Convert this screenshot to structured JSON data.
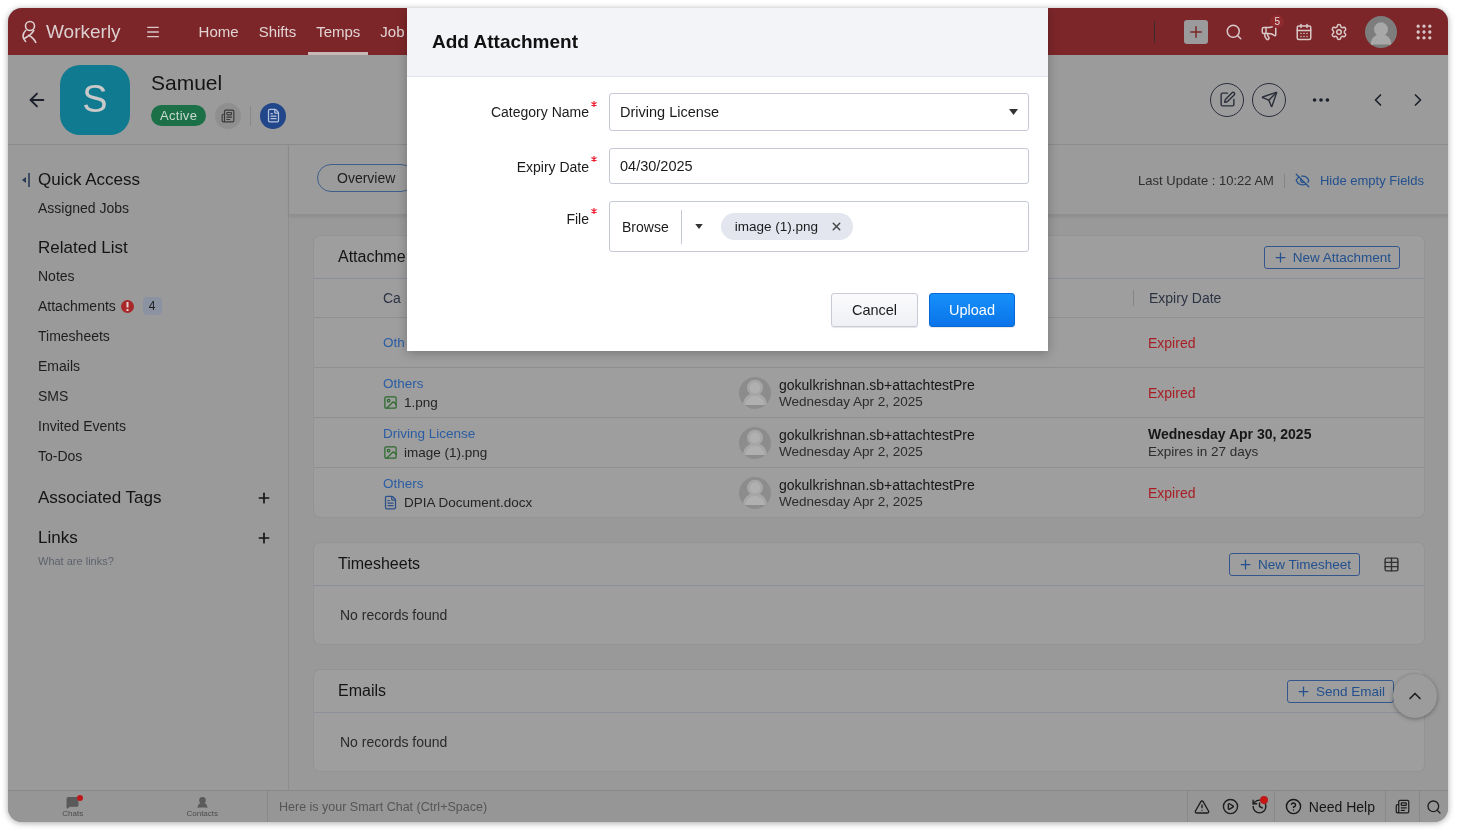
{
  "app": {
    "name": "Workerly"
  },
  "nav": [
    {
      "label": "Home",
      "selected": false
    },
    {
      "label": "Shifts",
      "selected": false
    },
    {
      "label": "Temps",
      "selected": true
    },
    {
      "label": "Job",
      "selected": false
    }
  ],
  "notifications_badge": "5",
  "profile": {
    "initial": "S",
    "name": "Samuel",
    "status": "Active"
  },
  "sidebar": {
    "sections": [
      {
        "title": "Quick Access",
        "items": [
          {
            "label": "Assigned Jobs",
            "alert": false
          }
        ]
      },
      {
        "title": "Related List",
        "items": [
          {
            "label": "Notes",
            "alert": false
          },
          {
            "label": "Attachments",
            "alert": true,
            "count": "4"
          },
          {
            "label": "Timesheets",
            "alert": false
          },
          {
            "label": "Emails",
            "alert": false
          },
          {
            "label": "SMS",
            "alert": false
          },
          {
            "label": "Invited Events",
            "alert": false
          },
          {
            "label": "To-Dos",
            "alert": false
          }
        ]
      }
    ],
    "tags": {
      "title": "Associated Tags"
    },
    "links": {
      "title": "Links",
      "hint": "What are links?"
    }
  },
  "tabs": [
    {
      "label": "Overview",
      "selected": true
    }
  ],
  "last_update": "Last Update : 10:22 AM",
  "hide_empty_link": "Hide empty Fields",
  "attachments": {
    "title": "Attachme",
    "button": "New Attachment",
    "columns": [
      "Ca",
      "Expiry Date"
    ],
    "rows": [
      {
        "category": "Oth",
        "expiry": {
          "text": "Expired",
          "expired": true
        }
      },
      {
        "category": "Others",
        "file": "1.png",
        "kind": "image",
        "uploader": "gokulkrishnan.sb+attachtestPre",
        "uploaded": "Wednesday Apr 2, 2025",
        "expiry": {
          "text": "Expired",
          "expired": true
        }
      },
      {
        "category": "Driving License",
        "file": "image (1).png",
        "kind": "image",
        "uploader": "gokulkrishnan.sb+attachtestPre",
        "uploaded": "Wednesday Apr 2, 2025",
        "expiry": {
          "text": "Wednesday Apr 30, 2025",
          "note": "Expires in 27 days",
          "expired": false
        }
      },
      {
        "category": "Others",
        "file": "DPIA Document.docx",
        "kind": "doc",
        "uploader": "gokulkrishnan.sb+attachtestPre",
        "uploaded": "Wednesday Apr 2, 2025",
        "expiry": {
          "text": "Expired",
          "expired": true
        }
      }
    ]
  },
  "timesheets": {
    "title": "Timesheets",
    "button": "New Timesheet",
    "empty": "No records found"
  },
  "emails": {
    "title": "Emails",
    "button": "Send Email",
    "empty": "No records found"
  },
  "bottom_bar": {
    "apps": [
      {
        "label": "Chats",
        "unread": true
      },
      {
        "label": "Contacts",
        "unread": false
      }
    ],
    "chat_placeholder": "Here is your Smart Chat (Ctrl+Space)",
    "help": "Need Help",
    "history_alert": true
  },
  "modal": {
    "title": "Add Attachment",
    "fields": [
      {
        "kind": "select",
        "label": "Category Name",
        "required": true,
        "value": "Driving License"
      },
      {
        "kind": "text",
        "label": "Expiry Date",
        "required": true,
        "value": "04/30/2025"
      },
      {
        "kind": "file",
        "label": "File",
        "required": true,
        "button": "Browse",
        "file": "image (1).png"
      }
    ],
    "buttons": [
      {
        "label": "Cancel",
        "kind": "secondary"
      },
      {
        "label": "Upload",
        "kind": "primary"
      }
    ]
  }
}
